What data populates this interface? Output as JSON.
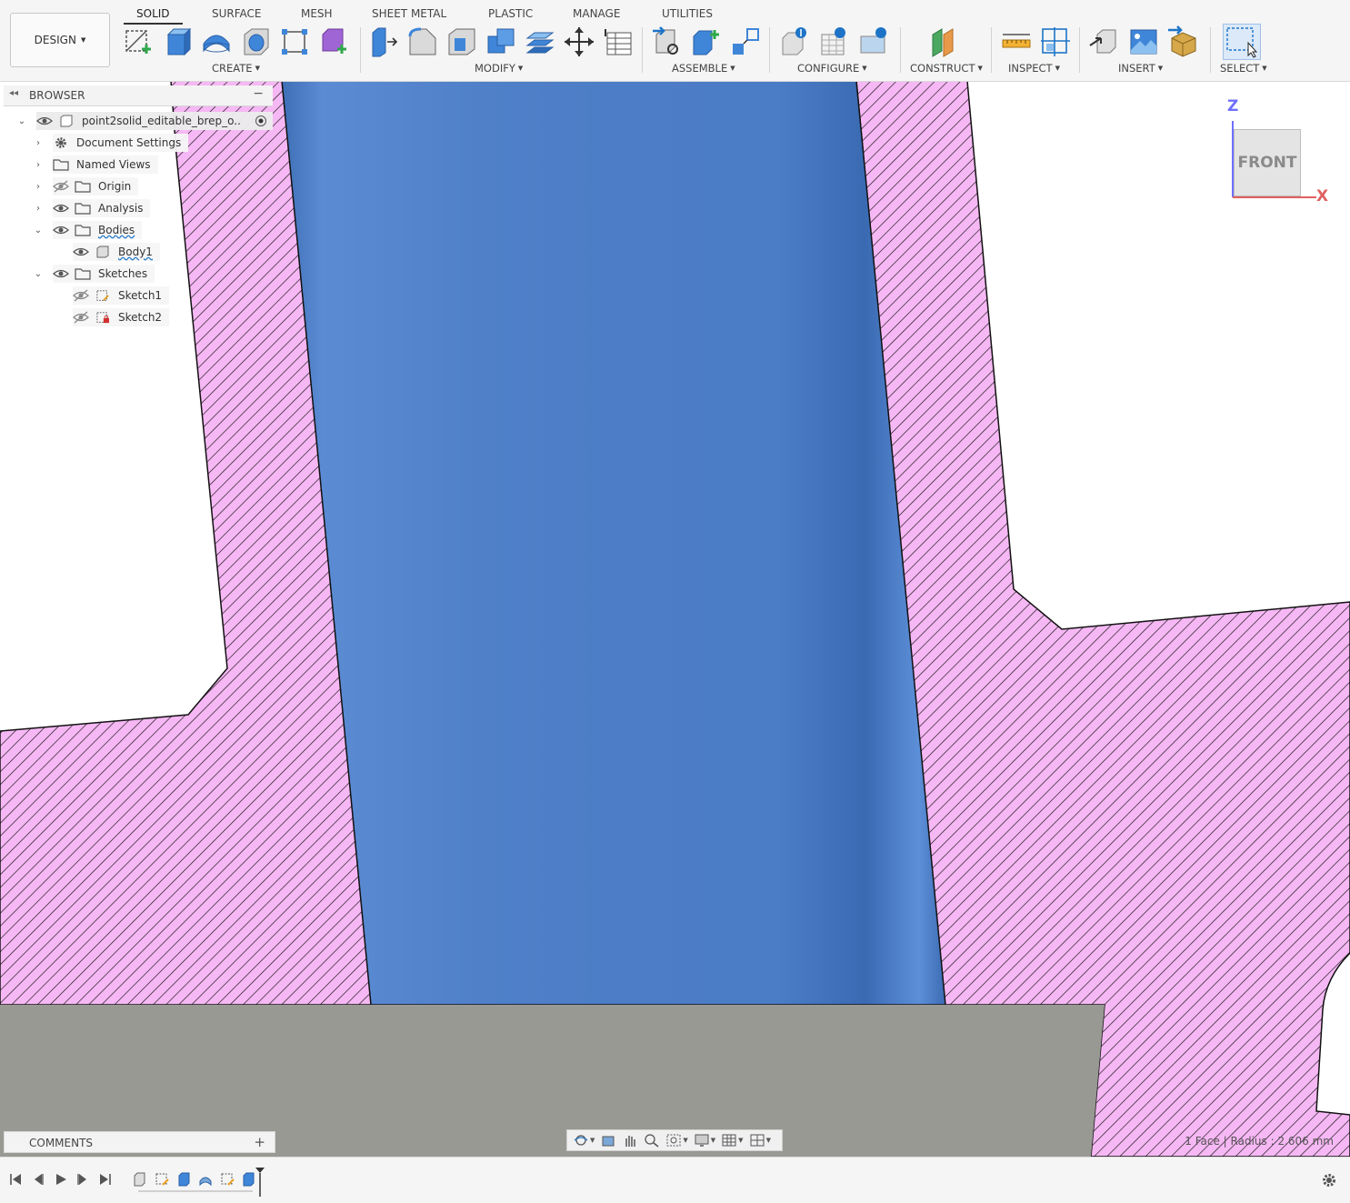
{
  "toolbar": {
    "workspace_button": "DESIGN",
    "tabs": [
      "SOLID",
      "SURFACE",
      "MESH",
      "SHEET METAL",
      "PLASTIC",
      "MANAGE",
      "UTILITIES"
    ],
    "groups": {
      "create": "CREATE",
      "modify": "MODIFY",
      "assemble": "ASSEMBLE",
      "configure": "CONFIGURE",
      "construct": "CONSTRUCT",
      "inspect": "INSPECT",
      "insert": "INSERT",
      "select": "SELECT"
    },
    "icons": {
      "create": [
        "create-sketch-icon",
        "extrude-icon",
        "revolve-icon",
        "hole-icon",
        "pattern-icon",
        "create-form-icon"
      ],
      "modify": [
        "press-pull-icon",
        "fillet-icon",
        "shell-icon",
        "combine-icon",
        "offset-face-icon",
        "move-icon",
        "parameters-icon"
      ],
      "assemble": [
        "joint-icon",
        "new-component-icon",
        "as-built-joint-icon"
      ],
      "configure": [
        "configure-icon",
        "configure-table-icon",
        "configure-theme-icon"
      ],
      "construct": [
        "offset-plane-icon"
      ],
      "inspect": [
        "measure-icon",
        "section-analysis-icon"
      ],
      "insert": [
        "insert-derive-icon",
        "decal-icon",
        "insert-mesh-icon"
      ],
      "select": [
        "select-window-icon"
      ]
    }
  },
  "browser": {
    "title": "BROWSER",
    "root": "point2solid_editable_brep_o...",
    "items": [
      {
        "label": "Document Settings",
        "icon": "gear-icon"
      },
      {
        "label": "Named Views",
        "icon": "folder-icon"
      },
      {
        "label": "Origin",
        "icon": "folder-icon",
        "hidden": true
      },
      {
        "label": "Analysis",
        "icon": "folder-icon"
      },
      {
        "label": "Bodies",
        "icon": "folder-icon",
        "expanded": true
      },
      {
        "label": "Body1",
        "icon": "body-icon"
      },
      {
        "label": "Sketches",
        "icon": "folder-icon",
        "expanded": true
      },
      {
        "label": "Sketch1",
        "icon": "sketch-icon",
        "hidden": true
      },
      {
        "label": "Sketch2",
        "icon": "sketch-locked-icon",
        "hidden": true
      }
    ]
  },
  "viewcube": {
    "face": "FRONT",
    "axis_z": "Z",
    "axis_x": "X"
  },
  "comments": {
    "title": "COMMENTS"
  },
  "status_text": "1 Face | Radius : 2.606 mm",
  "colors": {
    "hatch_fill": "#f6b8f4",
    "hatch_line": "#000000",
    "body_blue": "#4f80c8",
    "bottom_gray": "#999994",
    "accent_blue": "#0696d7"
  }
}
